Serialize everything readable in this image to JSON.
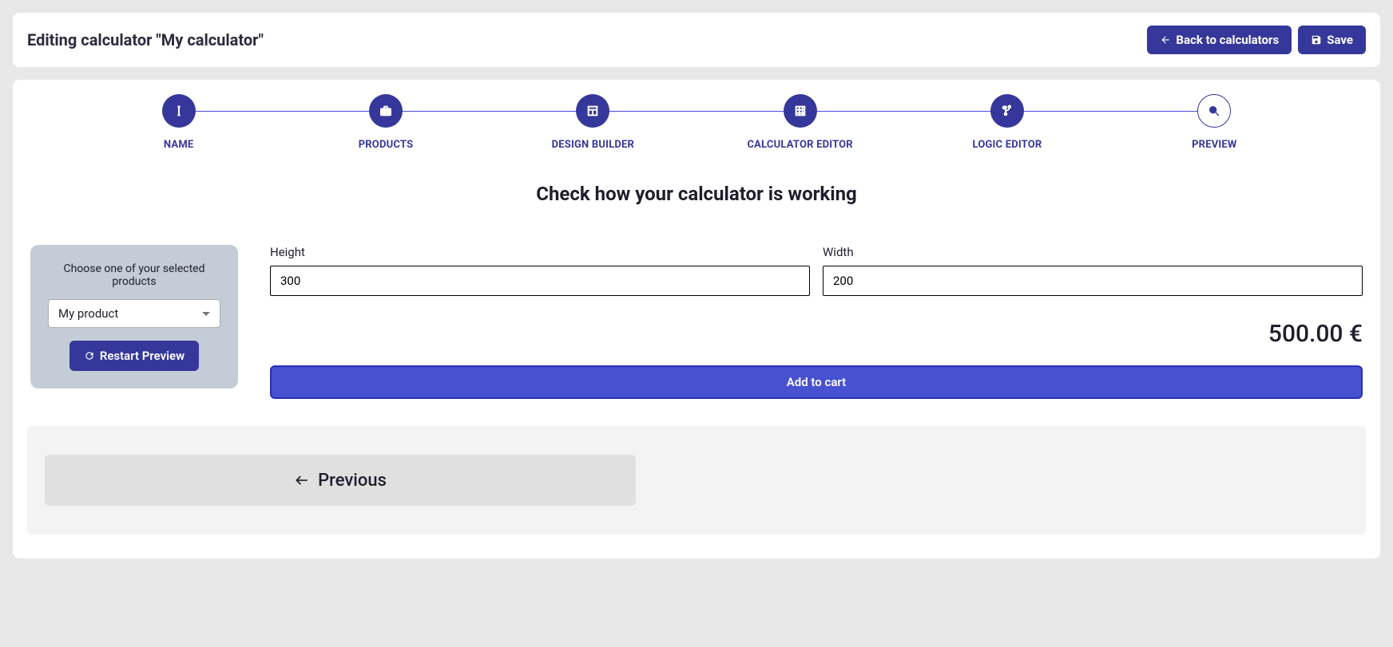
{
  "header": {
    "title": "Editing calculator \"My calculator\"",
    "back_label": "Back to calculators",
    "save_label": "Save"
  },
  "stepper": {
    "steps": [
      {
        "label": "NAME"
      },
      {
        "label": "PRODUCTS"
      },
      {
        "label": "DESIGN BUILDER"
      },
      {
        "label": "CALCULATOR EDITOR"
      },
      {
        "label": "LOGIC EDITOR"
      },
      {
        "label": "PREVIEW"
      }
    ]
  },
  "section_heading": "Check how your calculator is working",
  "sidebar": {
    "choose_label": "Choose one of your selected products",
    "selected_product": "My product",
    "restart_label": "Restart Preview"
  },
  "form": {
    "height": {
      "label": "Height",
      "value": "300"
    },
    "width": {
      "label": "Width",
      "value": "200"
    },
    "price": "500.00 €",
    "add_to_cart": "Add to cart"
  },
  "footer": {
    "previous": "Previous"
  }
}
